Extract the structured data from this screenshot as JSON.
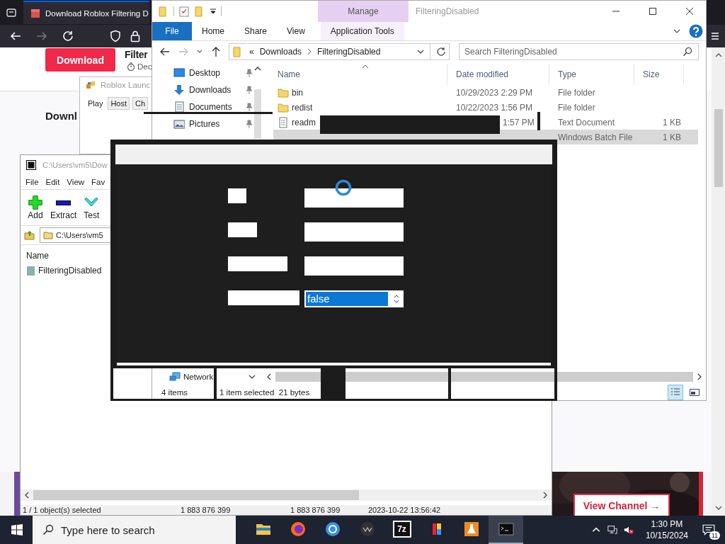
{
  "browser": {
    "tab_title": "Download Roblox Filtering D",
    "page": {
      "download_button": "Download",
      "post_title": "Filter",
      "post_date": "Dec",
      "section_heading": "Downl",
      "view_channel_button": "View Channel →"
    }
  },
  "roblox_launcher": {
    "title": "Roblox Launc",
    "tabs": [
      {
        "label": "Play",
        "selected": true
      },
      {
        "label": "Host",
        "selected": false
      },
      {
        "label": "Ch",
        "selected": false
      }
    ]
  },
  "sevenzip": {
    "title": "C:\\Users\\vm5\\Dow",
    "menu": [
      "File",
      "Edit",
      "View",
      "Fav"
    ],
    "toolbar": [
      {
        "label": "Add",
        "kind": "add"
      },
      {
        "label": "Extract",
        "kind": "extract"
      },
      {
        "label": "Test",
        "kind": "test"
      }
    ],
    "path": "C:\\Users\\vm5",
    "columns": [
      "Name"
    ],
    "items": [
      {
        "name": "FilteringDisabled"
      }
    ],
    "status": [
      "1 / 1 object(s) selected",
      "1 883 876 399",
      "1 883 876 399",
      "2023-10-22 13:56:42"
    ]
  },
  "explorer": {
    "context_tab": "Manage",
    "title": "FilteringDisabled",
    "ribbon_tabs": [
      {
        "label": "File",
        "kind": "file"
      },
      {
        "label": "Home",
        "kind": "tab"
      },
      {
        "label": "Share",
        "kind": "tab"
      },
      {
        "label": "View",
        "kind": "tab"
      },
      {
        "label": "Application Tools",
        "kind": "context"
      }
    ],
    "breadcrumb_overflow": "«",
    "breadcrumb": [
      "Downloads",
      "FilteringDisabled"
    ],
    "search_placeholder": "Search FilteringDisabled",
    "nav_items": [
      {
        "label": "Desktop",
        "kind": "desktop",
        "pinned": true
      },
      {
        "label": "Downloads",
        "kind": "downloads",
        "pinned": true
      },
      {
        "label": "Documents",
        "kind": "documents",
        "pinned": true
      },
      {
        "label": "Pictures",
        "kind": "pictures",
        "pinned": true
      }
    ],
    "network": "Network",
    "columns": [
      "Name",
      "Date modified",
      "Type",
      "Size"
    ],
    "rows": [
      {
        "name": "bin",
        "kind": "folder",
        "date": "10/29/2023 2:29 PM",
        "type": "File folder",
        "selected": false
      },
      {
        "name": "redist",
        "kind": "folder",
        "date": "10/22/2023 1:56 PM",
        "type": "File folder",
        "selected": false
      },
      {
        "name": "readm",
        "kind": "text",
        "date": "1:57 PM",
        "date_partly_hidden": true,
        "type": "Text Document",
        "size": "1 KB",
        "selected": false
      },
      {
        "type": "Windows Batch File",
        "size": "1 KB",
        "selected": true
      }
    ],
    "status": [
      "4 items",
      "1 item selected  21 bytes"
    ]
  },
  "dialog": {
    "busy": true,
    "fields": [
      {
        "kind": "text"
      },
      {
        "kind": "text"
      },
      {
        "kind": "text"
      },
      {
        "kind": "spinner",
        "value": "false",
        "selected": true
      }
    ]
  },
  "taskbar": {
    "search_placeholder": "Type here to search",
    "apps": [
      {
        "kind": "folder",
        "active": false
      },
      {
        "kind": "firefox",
        "active": false
      },
      {
        "kind": "chrome",
        "active": false
      },
      {
        "kind": "media",
        "active": false
      },
      {
        "kind": "sevenzip",
        "label": "7z",
        "active": false
      },
      {
        "kind": "paint",
        "active": false
      },
      {
        "kind": "flask",
        "active": false
      },
      {
        "kind": "terminal",
        "active": true
      }
    ],
    "muted": true,
    "time": "1:30 PM",
    "date": "10/15/2024",
    "notification_count": "11"
  }
}
